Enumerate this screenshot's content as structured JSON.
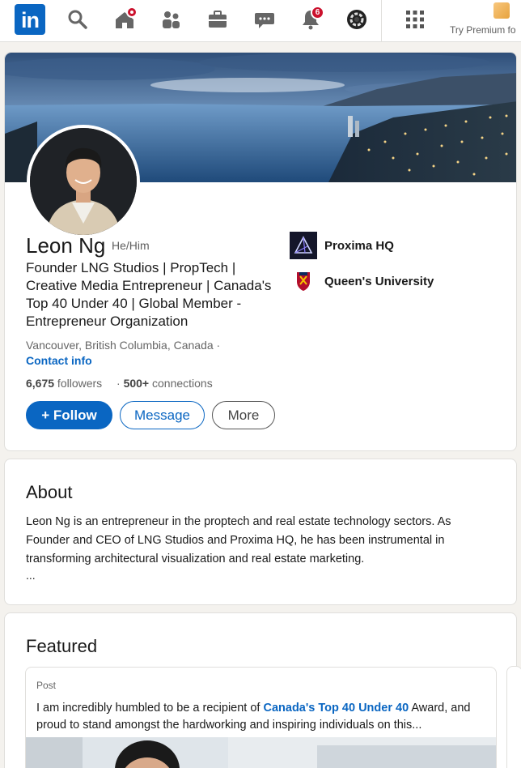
{
  "nav": {
    "logo_text": "in",
    "notifications_count": "6",
    "premium_label": "Try Premium fo"
  },
  "profile": {
    "name": "Leon Ng",
    "pronouns": "He/Him",
    "headline": "Founder LNG Studios | PropTech | Creative Media Entrepreneur | Canada's Top 40 Under 40 | Global Member - Entrepreneur Organization",
    "location": "Vancouver, British Columbia, Canada ·",
    "contact_info": "Contact info",
    "followers_count": "6,675",
    "followers_label": " followers",
    "connections_prefix": "· ",
    "connections_count": "500+",
    "connections_label": " connections",
    "follow_label": "+ Follow",
    "message_label": "Message",
    "more_label": "More",
    "orgs": [
      {
        "name": "Proxima HQ",
        "icon": "proxima-logo"
      },
      {
        "name": "Queen's University",
        "icon": "queens-crest"
      }
    ]
  },
  "about": {
    "title": "About",
    "text": "Leon Ng is an entrepreneur in the proptech and real estate technology sectors. As Founder and CEO of LNG Studios and Proxima HQ, he has been instrumental in transforming architectural visualization and real estate marketing.",
    "ellipsis": "..."
  },
  "featured": {
    "title": "Featured",
    "post_type": "Post",
    "post_text_before": "I am incredibly humbled to be a recipient of ",
    "post_link": "Canada's Top 40 Under 40",
    "post_text_after": " Award, and proud to stand amongst the hardworking and inspiring individuals on this..."
  },
  "colors": {
    "brand": "#0a66c2",
    "notification": "#cb112d",
    "background": "#f4f2ee"
  }
}
